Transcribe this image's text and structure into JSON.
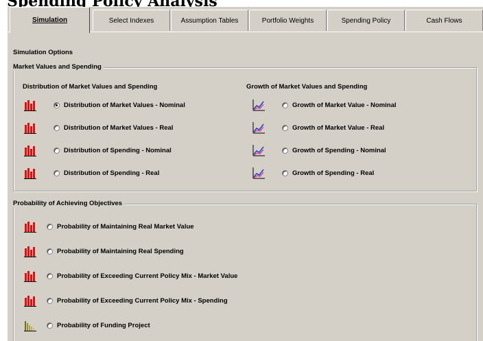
{
  "heading": "Spending Policy Analysis",
  "tabs": [
    {
      "label": "Simulation",
      "active": true
    },
    {
      "label": "Select Indexes",
      "active": false
    },
    {
      "label": "Assumption Tables",
      "active": false
    },
    {
      "label": "Portfolio Weights",
      "active": false
    },
    {
      "label": "Spending Policy",
      "active": false
    },
    {
      "label": "Cash Flows",
      "active": false
    }
  ],
  "simulation_options_label": "Simulation Options",
  "market_group": {
    "title": "Market Values and Spending",
    "distribution_heading": "Distribution of Market Values and Spending",
    "growth_heading": "Growth of Market Values and Spending",
    "distribution_options": [
      {
        "label": "Distribution of Market Values - Nominal",
        "icon": "bar-chart-icon",
        "selected": true
      },
      {
        "label": "Distribution of Market Values - Real",
        "icon": "bar-chart-icon",
        "selected": false
      },
      {
        "label": "Distribution of Spending - Nominal",
        "icon": "bar-chart-icon",
        "selected": false
      },
      {
        "label": "Distribution of Spending - Real",
        "icon": "bar-chart-icon",
        "selected": false
      }
    ],
    "growth_options": [
      {
        "label": "Growth of Market Value - Nominal",
        "icon": "line-chart-icon",
        "selected": false
      },
      {
        "label": "Growth of Market Value - Real",
        "icon": "line-chart-icon",
        "selected": false
      },
      {
        "label": "Growth of Spending - Nominal",
        "icon": "line-chart-icon",
        "selected": false
      },
      {
        "label": "Growth of Spending - Real",
        "icon": "line-chart-icon",
        "selected": false
      }
    ]
  },
  "probability_group": {
    "title": "Probability of Achieving Objectives",
    "options": [
      {
        "label": "Probability of Maintaining Real Market Value",
        "icon": "bar-chart-icon",
        "selected": false
      },
      {
        "label": "Probability of Maintaining Real Spending",
        "icon": "bar-chart-icon",
        "selected": false
      },
      {
        "label": "Probability of Exceeding Current Policy Mix -  Market Value",
        "icon": "bar-chart-icon",
        "selected": false
      },
      {
        "label": "Probability of Exceeding Current Policy Mix -  Spending",
        "icon": "bar-chart-icon",
        "selected": false
      },
      {
        "label": "Probability of Funding Project",
        "icon": "histogram-icon",
        "selected": false
      }
    ]
  },
  "colors": {
    "window_bg": "#d4d0c8",
    "bar_icon_red": "#e01010",
    "line_icon_blue": "#2040c0",
    "line_icon_pink": "#e040a0"
  }
}
